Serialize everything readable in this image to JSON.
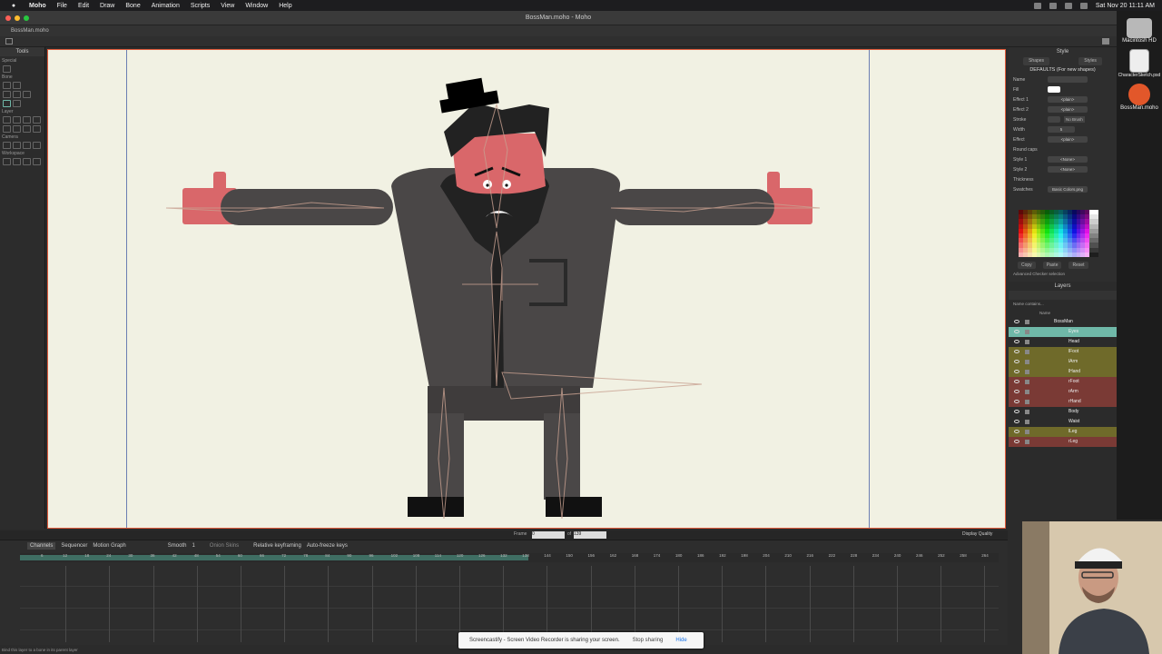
{
  "menubar": {
    "app": "Moho",
    "items": [
      "File",
      "Edit",
      "Draw",
      "Bone",
      "Animation",
      "Scripts",
      "View",
      "Window",
      "Help"
    ],
    "datetime": "Sat Nov 20  11:11 AM"
  },
  "window": {
    "title": "BossMan.moho - Moho",
    "tab": "BossMan.moho"
  },
  "tools": {
    "header": "Tools",
    "groups": [
      "Special",
      "Bone",
      "Layer",
      "Camera",
      "Workspace"
    ]
  },
  "style": {
    "title": "Style",
    "tabs": [
      "Shapes",
      "Styles"
    ],
    "defaults": "DEFAULTS (For new shapes)",
    "rows": [
      {
        "label": "Name",
        "value": ""
      },
      {
        "label": "Fill",
        "value": ""
      },
      {
        "label": "Effect 1",
        "value": "<plain>"
      },
      {
        "label": "Effect 2",
        "value": "<plain>"
      },
      {
        "label": "Stroke",
        "value": ""
      },
      {
        "label": "Width",
        "value": "5"
      },
      {
        "label": "Effect",
        "value": "<plain>"
      },
      {
        "label": "Round caps",
        "value": ""
      },
      {
        "label": "Style 1",
        "value": "<None>"
      },
      {
        "label": "Style 2",
        "value": "<None>"
      },
      {
        "label": "Thickness",
        "value": ""
      },
      {
        "label": "Swatches",
        "value": "Basic Colors.png"
      }
    ],
    "no_brush": "No Brush",
    "buttons": [
      "Copy",
      "Paste",
      "Reset"
    ],
    "checks": "Advanced   Checker selection"
  },
  "layers": {
    "title": "Layers",
    "filter": "Name contains...",
    "col_name": "Name",
    "items": [
      {
        "name": "BossMan",
        "color": "#2b2b2b"
      },
      {
        "name": "Eyes",
        "color": "#6fb8a8"
      },
      {
        "name": "Head",
        "color": "#2b2b2b"
      },
      {
        "name": "lFoot",
        "color": "#6f6a2a"
      },
      {
        "name": "lArm",
        "color": "#6f6a2a"
      },
      {
        "name": "lHand",
        "color": "#6f6a2a"
      },
      {
        "name": "rFoot",
        "color": "#7a3a35"
      },
      {
        "name": "rArm",
        "color": "#7a3a35"
      },
      {
        "name": "rHand",
        "color": "#7a3a35"
      },
      {
        "name": "Body",
        "color": "#2b2b2b"
      },
      {
        "name": "Waist",
        "color": "#2b2b2b"
      },
      {
        "name": "lLeg",
        "color": "#6f6a2a"
      },
      {
        "name": "rLeg",
        "color": "#7a3a35"
      }
    ]
  },
  "desktop": {
    "items": [
      "Macintosh HD",
      "CharacterSketch.psd",
      "BossMan.moho"
    ]
  },
  "timeline": {
    "tabs": [
      "Channels",
      "Sequencer",
      "Motion Graph"
    ],
    "interp": "Smooth",
    "interp_n": "1",
    "onion": "Onion Skins",
    "relative": "Relative keyframing",
    "autofreeze": "Auto-freeze keys",
    "frame_label": "Frame",
    "frame_value": "0",
    "of_label": "of",
    "of_value": "139",
    "display_quality": "Display Quality",
    "ticks": [
      "6",
      "12",
      "18",
      "24",
      "30",
      "36",
      "42",
      "48",
      "54",
      "60",
      "66",
      "72",
      "78",
      "84",
      "90",
      "96",
      "102",
      "108",
      "114",
      "120",
      "126",
      "132",
      "138",
      "144",
      "150",
      "156",
      "162",
      "168",
      "174",
      "180",
      "186",
      "192",
      "198",
      "204",
      "210",
      "216",
      "222",
      "228",
      "234",
      "240",
      "246",
      "252",
      "258",
      "264"
    ]
  },
  "status": {
    "hint": "Bind this layer to a bone in its parent layer",
    "frame": "Frame: 0"
  },
  "sharebar": {
    "message": "Screencastify - Screen Video Recorder is sharing your screen.",
    "stop": "Stop sharing",
    "hide": "Hide"
  },
  "colors": {
    "accent": "#e05a3a",
    "canvas": "#f1f1e3",
    "skin": "#d9676a",
    "suit": "#4a4747",
    "dark": "#222222"
  }
}
